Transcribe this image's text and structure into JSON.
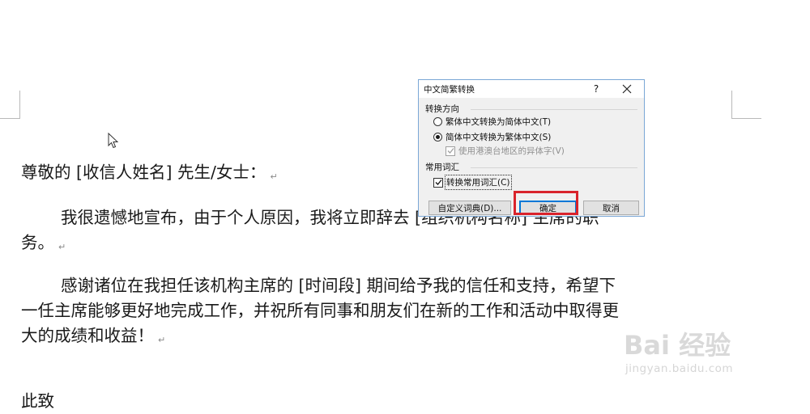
{
  "document": {
    "paragraphs": [
      {
        "lines": [
          "尊敬的 [收信人姓名] 先生/女士：↵"
        ]
      },
      {
        "lines": [
          "我很遗憾地宣布，由于个人原因，我将立即辞去 [组织机构名称] 主席的职",
          "务。↵"
        ]
      },
      {
        "lines": [
          "感谢诸位在我担任该机构主席的 [时间段] 期间给予我的信任和支持，希望下",
          "一任主席能够更好地完成工作，并祝所有同事和朋友们在新的工作和活动中取得更",
          "大的成绩和收益！↵"
        ]
      },
      {
        "lines": [
          "此致"
        ]
      }
    ]
  },
  "dialog": {
    "title": "中文简繁转换",
    "help_label": "?",
    "direction_group": {
      "title": "转换方向",
      "option_trad_to_simp": "繁体中文转换为简体中文(T)",
      "option_simp_to_trad": "简体中文转换为繁体中文(S)",
      "selected": "简体中文转换为繁体中文(S)",
      "option_hk_tw_variants": "使用港澳台地区的异体字(V)",
      "hk_tw_variants_checked": true,
      "hk_tw_variants_enabled": false
    },
    "vocab_group": {
      "title": "常用词汇",
      "option_convert_common": "转换常用词汇(C)",
      "convert_common_checked": true
    },
    "buttons": {
      "custom_dictionary": "自定义词典(D)...",
      "ok": "确定",
      "cancel": "取消"
    },
    "highlight_color": "#d9232b",
    "accent_color": "#0078d7"
  },
  "watermark": {
    "brand": "Bai 经验",
    "url": "jingyan.baidu.com"
  }
}
